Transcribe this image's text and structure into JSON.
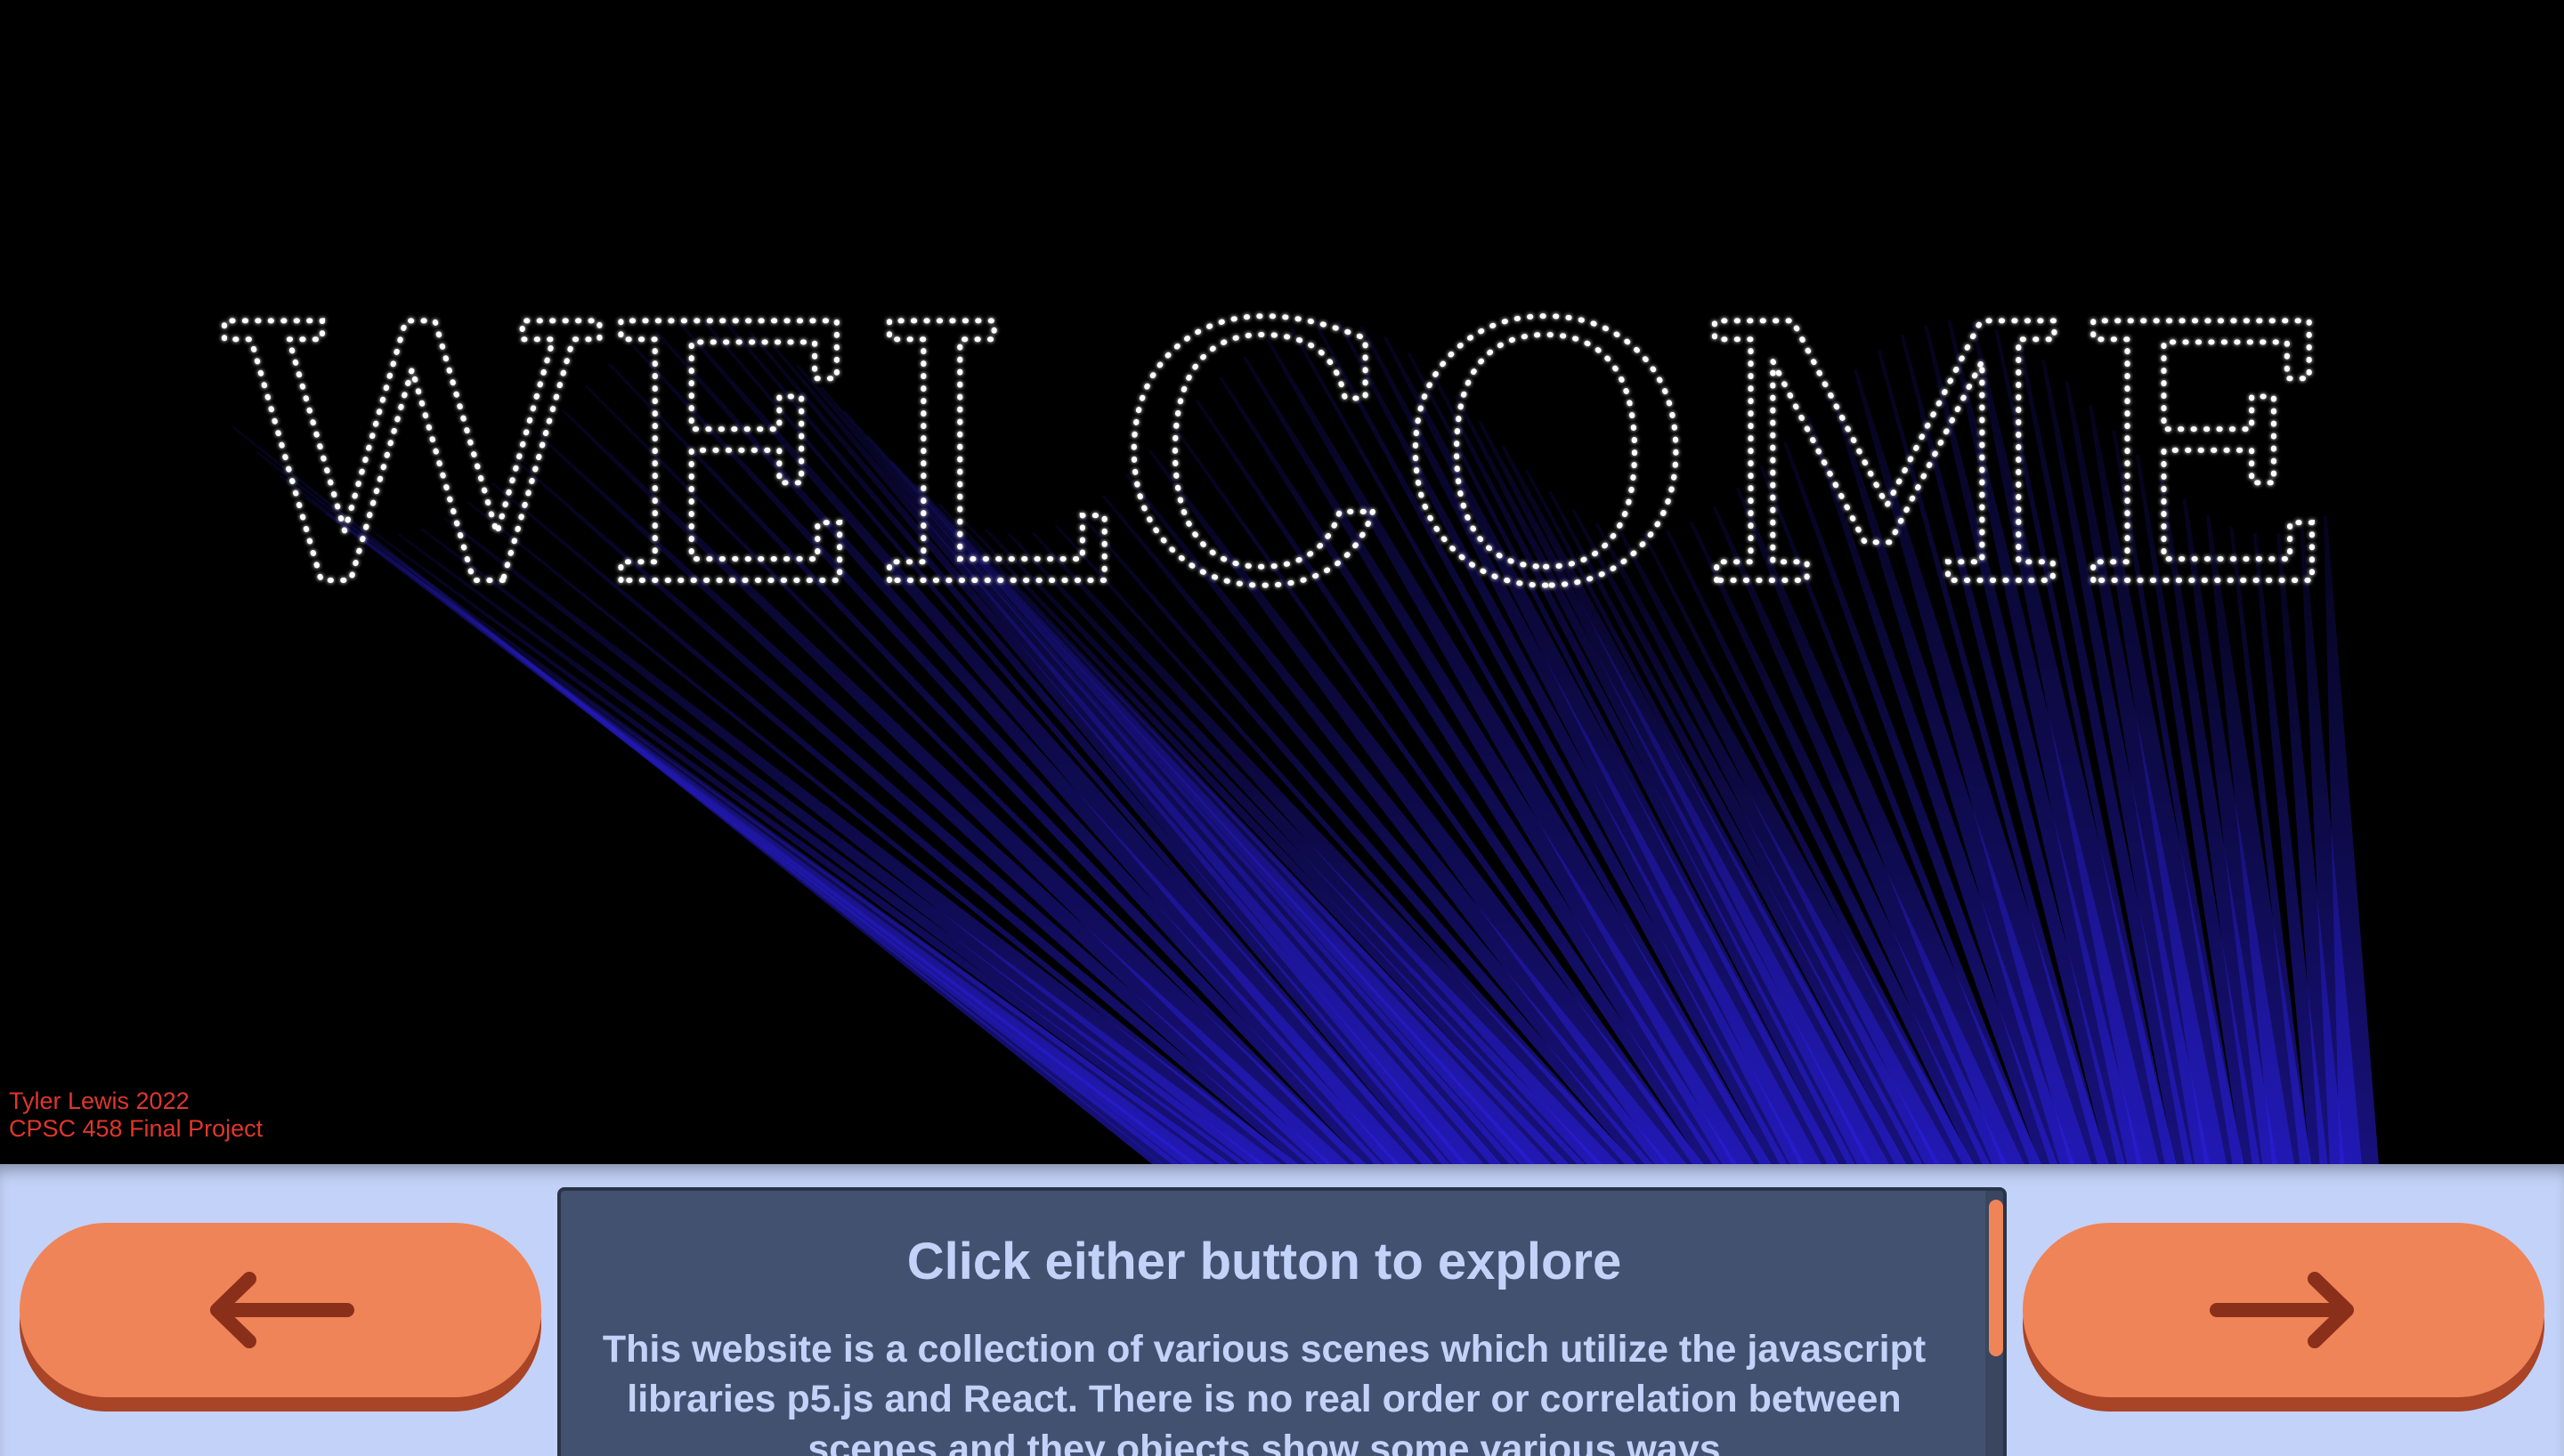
{
  "hero": {
    "word": "WELCOME",
    "dot_color": "#ffffff",
    "beam_color": "#2a1fe0"
  },
  "credits": {
    "line1": "Tyler Lewis 2022",
    "line2": "CPSC 458 Final Project",
    "color": "#e0362c"
  },
  "nav": {
    "prev_icon": "arrow-left-icon",
    "next_icon": "arrow-right-icon",
    "button_color": "#ef8458",
    "arrow_color": "#8a2f1a"
  },
  "info": {
    "title": "Click either button to explore",
    "body": "This website is a collection of various scenes which utilize the javascript libraries p5.js and React. There is no real order or correlation between scenes and they objects show some various ways"
  },
  "colors": {
    "bar_background": "#c3d2f8",
    "panel_background": "#435170"
  }
}
